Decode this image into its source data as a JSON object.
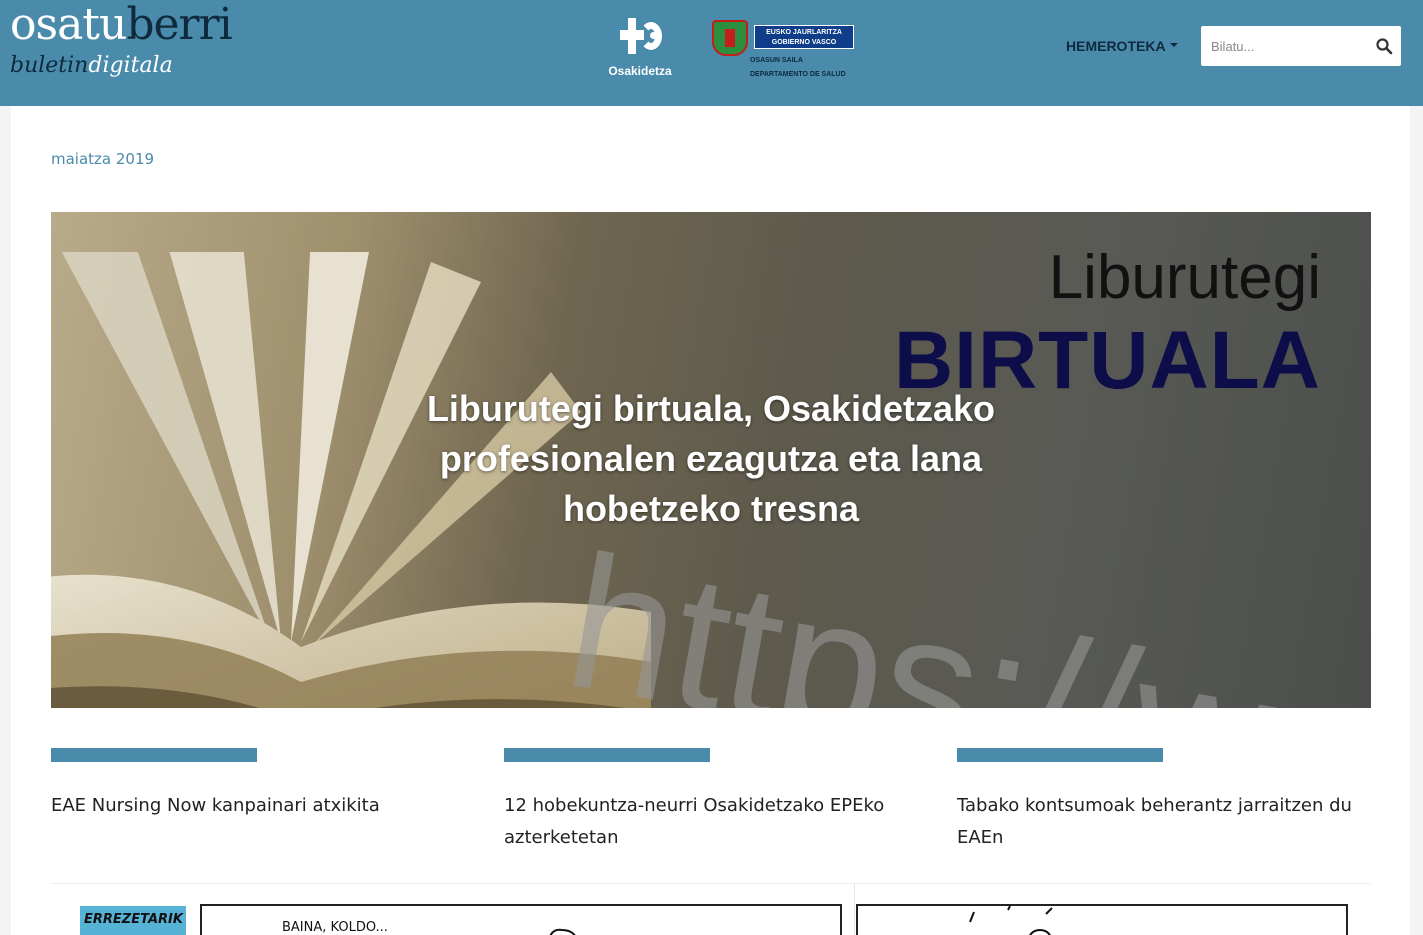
{
  "header": {
    "brand_part1": "osatu",
    "brand_part2": "berri",
    "brand_sub_part1": "buletin",
    "brand_sub_part2": "digitala",
    "osakidetza_label": "Osakidetza",
    "gov_box_line1": "EUSKO JAURLARITZA",
    "gov_box_line2": "GOBIERNO VASCO",
    "gov_sub_line1": "OSASUN SAILA",
    "gov_sub_line2": "DEPARTAMENTO DE SALUD",
    "menu_label": "HEMEROTEKA",
    "search_placeholder": "Bilatu..."
  },
  "colors": {
    "header_bg": "#4a8bab",
    "accent": "#4a8bab",
    "brand_dark": "#0e2a3c"
  },
  "main": {
    "date": "maiatza 2019",
    "hero": {
      "image_word1": "Liburutegi",
      "image_word2": "BIRTUALA",
      "image_url_text": "https://www",
      "headline": "Liburutegi birtuala, Osakidetzako profesionalen ezagutza eta lana hobetzeko tresna"
    },
    "news": [
      {
        "title": "EAE Nursing Now kanpainari atxikita"
      },
      {
        "title": "12 hobekuntza-neurri Osakidetzako EPEko azterketetan"
      },
      {
        "title": "Tabako kontsumoak beherantz jarraitzen du EAEn"
      }
    ],
    "comics": {
      "tag": "ERREZETARIK",
      "panel1_text": "BAINA, KOLDO..."
    }
  }
}
